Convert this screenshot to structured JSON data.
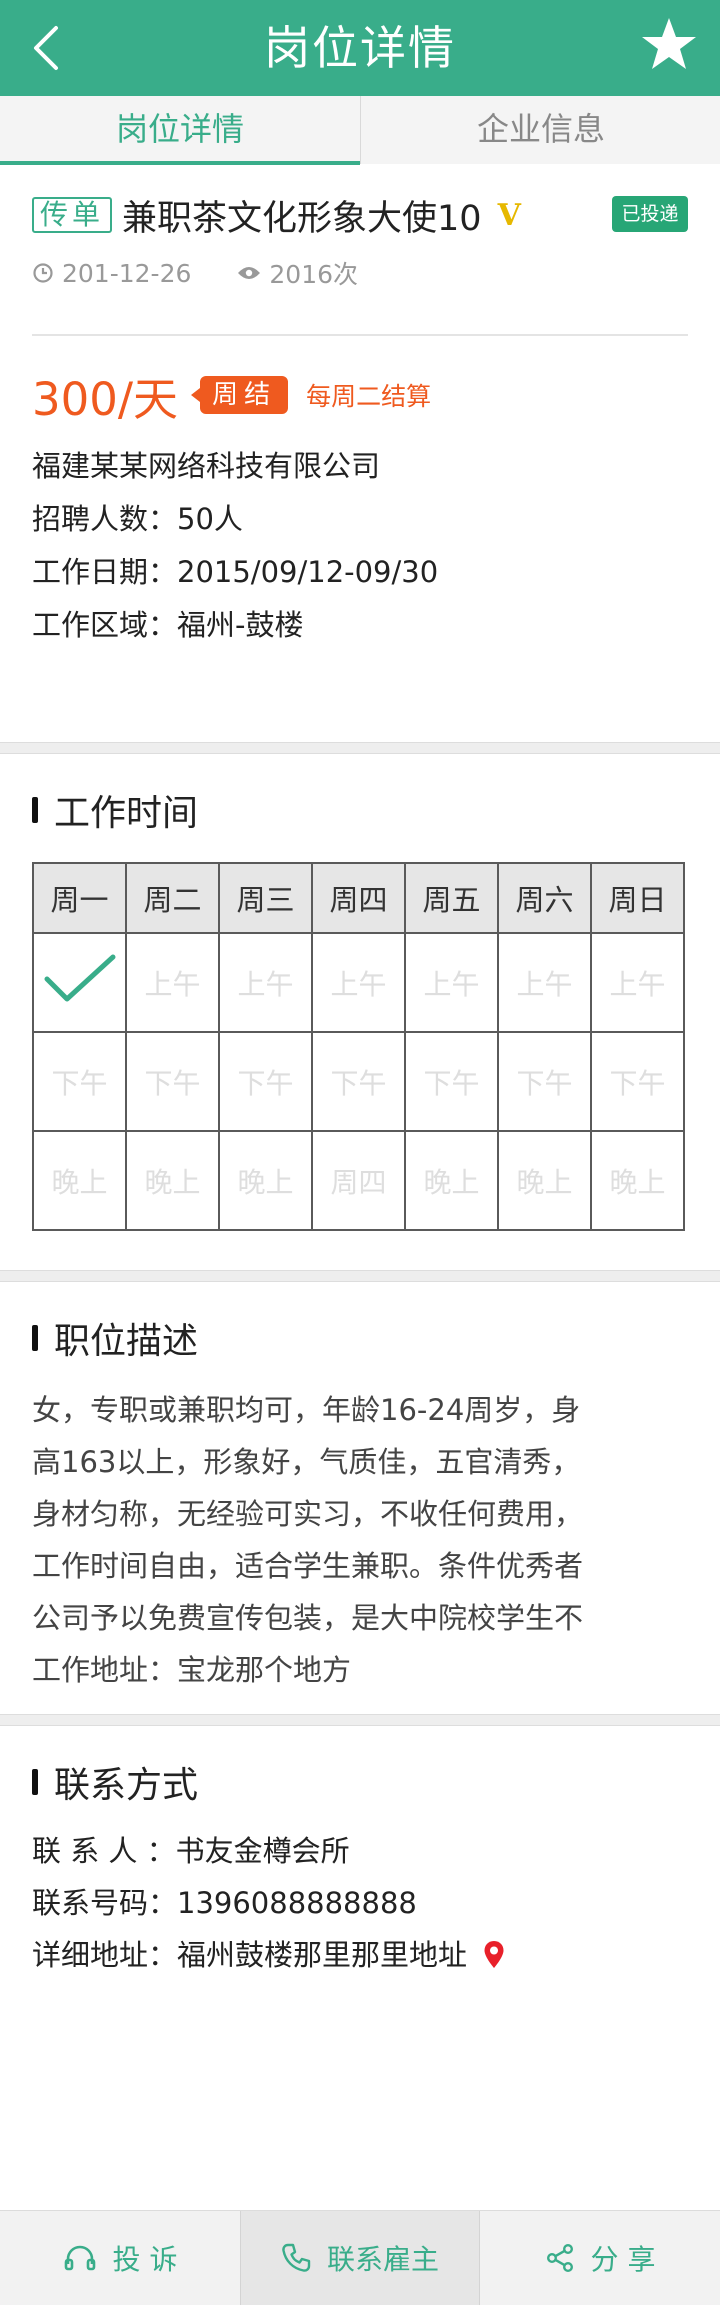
{
  "header": {
    "title": "岗位详情"
  },
  "tabs": [
    {
      "label": "岗位详情",
      "active": true
    },
    {
      "label": "企业信息",
      "active": false
    }
  ],
  "job": {
    "type_tag": "传单",
    "title": "兼职茶文化形象大使10",
    "v_badge": "V",
    "status_badge": "已投递",
    "date": "201-12-26",
    "views": "2016次",
    "salary": "300/天",
    "settle_badge": "周结",
    "settle_note": "每周二结算",
    "company": "福建某某网络科技有限公司",
    "headcount": "招聘人数：50人",
    "work_dates": "工作日期：2015/09/12-09/30",
    "work_area": "工作区域：福州-鼓楼"
  },
  "schedule": {
    "title": "工作时间",
    "days": [
      "周一",
      "周二",
      "周三",
      "周四",
      "周五",
      "周六",
      "周日"
    ],
    "rows": [
      [
        "✓",
        "上午",
        "上午",
        "上午",
        "上午",
        "上午",
        "上午"
      ],
      [
        "下午",
        "下午",
        "下午",
        "下午",
        "下午",
        "下午",
        "下午"
      ],
      [
        "晚上",
        "晚上",
        "晚上",
        "周四",
        "晚上",
        "晚上",
        "晚上"
      ]
    ]
  },
  "description": {
    "title": "职位描述",
    "lines": [
      "女，专职或兼职均可，年龄16-24周岁，身",
      "高163以上，形象好，气质佳，五官清秀，",
      "身材匀称，无经验可实习，不收任何费用，",
      "工作时间自由，适合学生兼职。条件优秀者",
      "公司予以免费宣传包装，是大中院校学生不",
      "工作地址：宝龙那个地方"
    ]
  },
  "contact": {
    "title": "联系方式",
    "person": "联 系 人 ：书友金樽会所",
    "phone": "联系号码：1396088888888",
    "address": "详细地址：福州鼓楼那里那里地址"
  },
  "bottom_bar": {
    "complain": "投 诉",
    "contact_employer": "联系雇主",
    "share": "分 享"
  },
  "colors": {
    "primary": "#39ad8a",
    "accent": "#ef5a1f",
    "badge_green": "#27a676",
    "v_gold": "#e6b800"
  },
  "icons": [
    "back-arrow-icon",
    "star-icon",
    "clock-icon",
    "eye-icon",
    "checkmark-icon",
    "location-pin-icon",
    "headset-icon",
    "phone-icon",
    "share-icon"
  ]
}
